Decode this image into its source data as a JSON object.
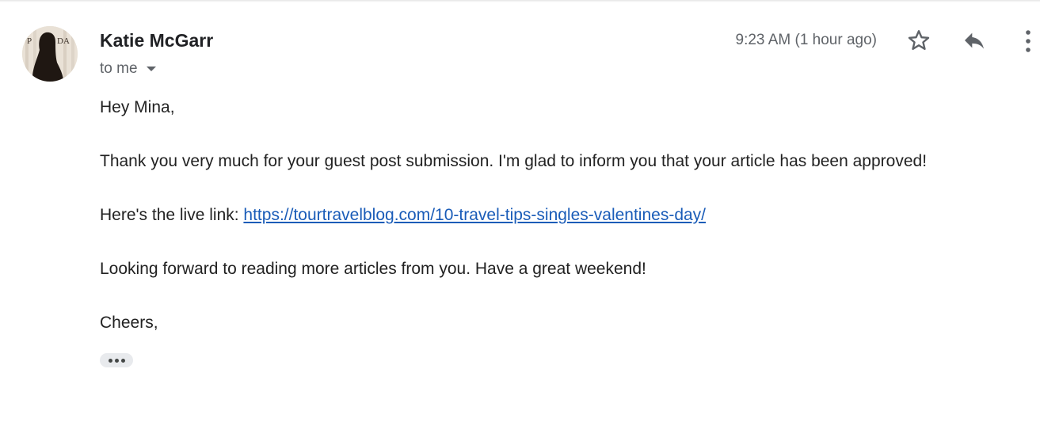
{
  "message": {
    "sender_name": "Katie McGarr",
    "recipient_label": "to me",
    "timestamp": "9:23 AM (1 hour ago)",
    "greeting": "Hey Mina,",
    "paragraph_1": "Thank you very much for your guest post submission. I'm glad to inform you that your article has been approved!",
    "live_link_prefix": "Here's the live link: ",
    "live_link_url": "https://tourtravelblog.com/10-travel-tips-singles-valentines-day/",
    "paragraph_3": "Looking forward to reading more articles from you. Have a great weekend!",
    "sign_off": "Cheers,"
  },
  "icons": {
    "avatar": "sender-avatar",
    "recipient_details": "chevron-down-icon",
    "star": "star-outline-icon",
    "reply": "reply-icon",
    "more": "more-vert-icon",
    "trimmed": "show-trimmed-content-icon"
  },
  "colors": {
    "link": "#1a5cb8",
    "muted_text": "#5f6368",
    "body_text": "#222222",
    "chip_background": "#e8eaed"
  }
}
